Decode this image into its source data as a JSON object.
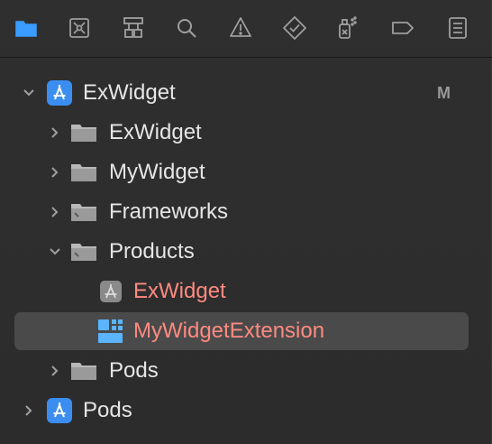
{
  "toolbar": {
    "tabs": [
      {
        "name": "project-navigator",
        "icon": "folder-icon",
        "active": true
      },
      {
        "name": "source-control-navigator",
        "icon": "source-control-icon",
        "active": false
      },
      {
        "name": "symbol-navigator",
        "icon": "hierarchy-icon",
        "active": false
      },
      {
        "name": "find-navigator",
        "icon": "search-icon",
        "active": false
      },
      {
        "name": "issue-navigator",
        "icon": "warning-icon",
        "active": false
      },
      {
        "name": "test-navigator",
        "icon": "test-diamond-icon",
        "active": false
      },
      {
        "name": "debug-navigator",
        "icon": "spray-can-icon",
        "active": false
      },
      {
        "name": "breakpoint-navigator",
        "icon": "breakpoint-tag-icon",
        "active": false
      },
      {
        "name": "report-navigator",
        "icon": "report-list-icon",
        "active": false
      }
    ],
    "active_color": "#3b9cff"
  },
  "tree": {
    "items": [
      {
        "label": "ExWidget",
        "kind": "project",
        "expanded": true,
        "badge": "M"
      },
      {
        "label": "ExWidget",
        "kind": "folder",
        "expanded": false
      },
      {
        "label": "MyWidget",
        "kind": "folder",
        "expanded": false
      },
      {
        "label": "Frameworks",
        "kind": "group-folder",
        "expanded": false
      },
      {
        "label": "Products",
        "kind": "group-folder",
        "expanded": true
      },
      {
        "label": "ExWidget",
        "kind": "app-product",
        "missing": true
      },
      {
        "label": "MyWidgetExtension",
        "kind": "extension-product",
        "missing": true,
        "selected": true
      },
      {
        "label": "Pods",
        "kind": "folder",
        "expanded": false
      },
      {
        "label": "Pods",
        "kind": "project",
        "expanded": false
      }
    ],
    "missing_color": "#ff8a80",
    "project_icon_color": "#3b8ef0"
  }
}
